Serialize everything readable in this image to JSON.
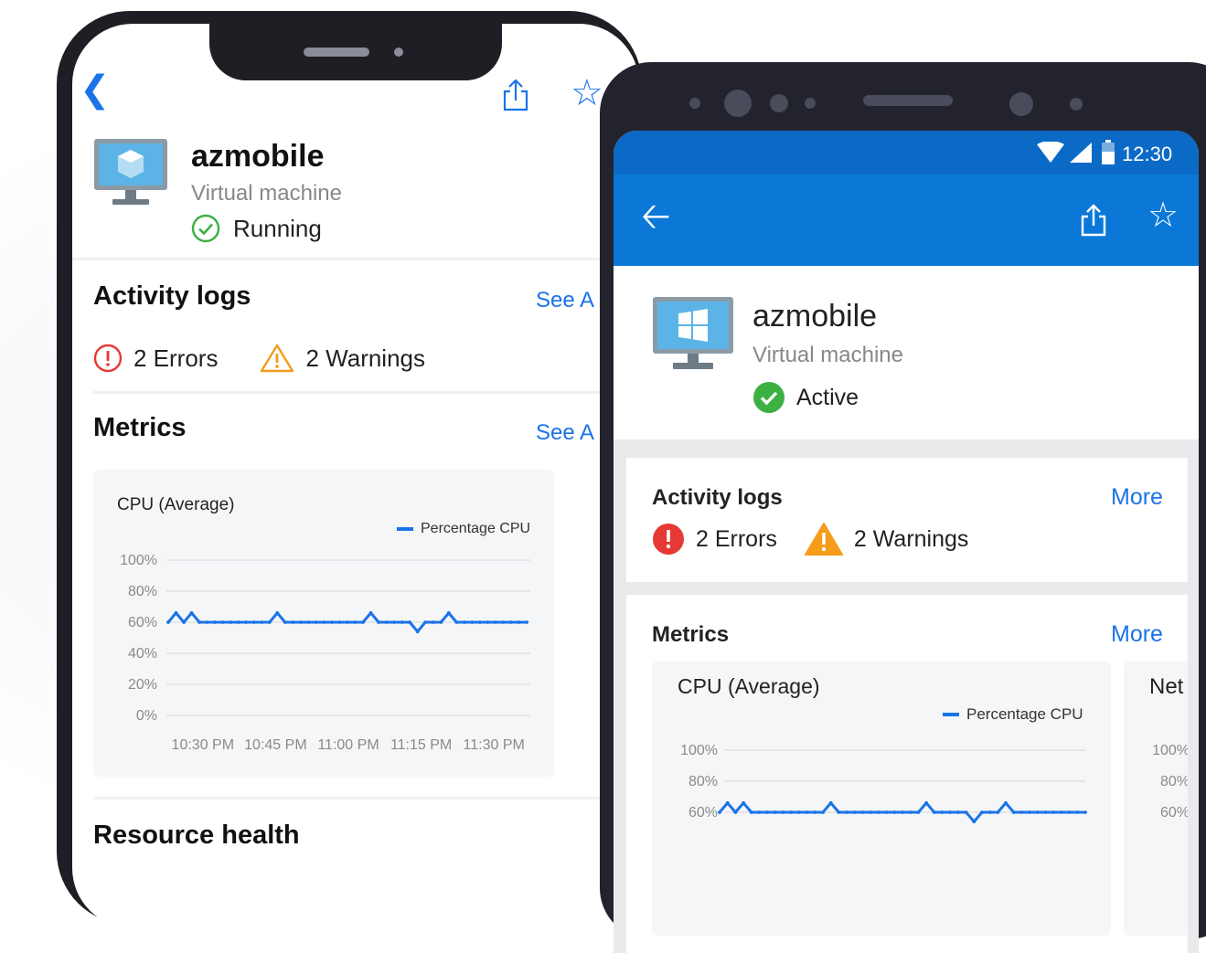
{
  "ios": {
    "resource_name": "azmobile",
    "resource_type": "Virtual machine",
    "status": "Running",
    "activity": {
      "title": "Activity logs",
      "see_all": "See A",
      "errors": "2 Errors",
      "warnings": "2 Warnings"
    },
    "metrics": {
      "title": "Metrics",
      "see_all": "See A",
      "chart_title": "CPU (Average)",
      "legend": "Percentage CPU"
    },
    "resource_health": {
      "title": "Resource health"
    }
  },
  "android": {
    "time": "12:30",
    "resource_name": "azmobile",
    "resource_type": "Virtual machine",
    "status": "Active",
    "activity": {
      "title": "Activity logs",
      "more": "More",
      "errors": "2 Errors",
      "warnings": "2 Warnings"
    },
    "metrics": {
      "title": "Metrics",
      "more": "More",
      "chart_title": "CPU (Average)",
      "legend": "Percentage CPU",
      "second_chart_title": "Net"
    }
  },
  "colors": {
    "ios_accent": "#1a73e8",
    "android_appbar": "#0b78d8",
    "android_statusbar": "#0b6ac6",
    "error": "#e53935",
    "warning": "#f59c1a",
    "success": "#3cb043"
  },
  "chart_data": [
    {
      "type": "line",
      "title": "CPU (Average)",
      "legend_position": "top-right",
      "y_ticks": [
        "100%",
        "80%",
        "60%",
        "40%",
        "20%",
        "0%"
      ],
      "x_ticks": [
        "10:30 PM",
        "10:45 PM",
        "11:00 PM",
        "11:15 PM",
        "11:30 PM"
      ],
      "ylim": [
        0,
        100
      ],
      "grid": true,
      "series": [
        {
          "name": "Percentage CPU",
          "color": "#1a73e8",
          "values": [
            60,
            66,
            60,
            66,
            60,
            60,
            60,
            60,
            60,
            60,
            60,
            60,
            60,
            60,
            66,
            60,
            60,
            60,
            60,
            60,
            60,
            60,
            60,
            60,
            60,
            60,
            66,
            60,
            60,
            60,
            60,
            60,
            54,
            60,
            60,
            60,
            66,
            60,
            60,
            60,
            60,
            60,
            60,
            60,
            60,
            60,
            60
          ]
        }
      ]
    },
    {
      "type": "line",
      "title": "CPU (Average)",
      "legend_position": "top-right",
      "y_ticks": [
        "100%",
        "80%",
        "60%"
      ],
      "ylim": [
        0,
        100
      ],
      "grid": true,
      "series": [
        {
          "name": "Percentage CPU",
          "color": "#1a73e8",
          "values": [
            60,
            66,
            60,
            66,
            60,
            60,
            60,
            60,
            60,
            60,
            60,
            60,
            60,
            60,
            66,
            60,
            60,
            60,
            60,
            60,
            60,
            60,
            60,
            60,
            60,
            60,
            66,
            60,
            60,
            60,
            60,
            60,
            54,
            60,
            60,
            60,
            66,
            60,
            60,
            60,
            60,
            60,
            60,
            60,
            60,
            60,
            60
          ]
        }
      ]
    },
    {
      "type": "line",
      "title": "Net",
      "y_ticks": [
        "100%",
        "80%",
        "60%"
      ],
      "ylim": [
        0,
        100
      ]
    }
  ]
}
